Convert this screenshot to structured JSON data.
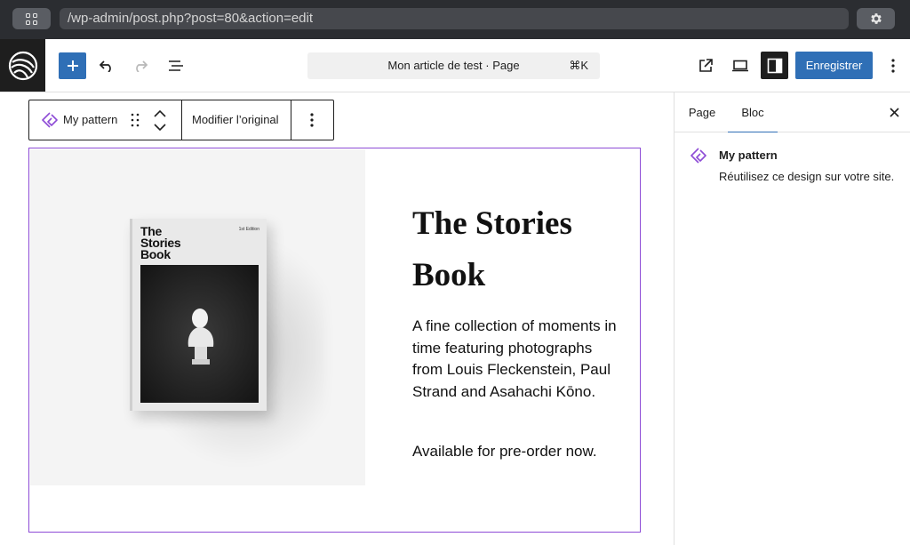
{
  "browser": {
    "url": "/wp-admin/post.php?post=80&action=edit"
  },
  "header": {
    "doc_title": "Mon article de test · Page",
    "shortcut": "⌘K",
    "save_label": "Enregistrer"
  },
  "block_toolbar": {
    "block_name": "My pattern",
    "edit_original_label": "Modifier l’original"
  },
  "content": {
    "book_cover": {
      "title_lines": [
        "The",
        "Stories",
        "Book"
      ],
      "edition": "1st Edition"
    },
    "heading": "The Stories Book",
    "paragraph1": "A fine collection of moments in time featuring photographs from Louis Fleckenstein, Paul Strand and Asahachi Kōno.",
    "paragraph2": "Available for pre-order now."
  },
  "sidebar": {
    "tabs": [
      {
        "label": "Page",
        "active": false
      },
      {
        "label": "Bloc",
        "active": true
      }
    ],
    "block_card": {
      "name": "My pattern",
      "description": "Réutilisez ce design sur votre site."
    }
  },
  "colors": {
    "primary": "#2f6fb6",
    "pattern_accent": "#8d4bd6",
    "browser_chrome": "#2b2d31",
    "logo_bg": "#1e1e1e"
  },
  "icons": [
    "tabs-grid-icon",
    "gear-icon",
    "site-logo",
    "plus-icon",
    "undo-icon",
    "redo-icon",
    "document-overview-icon",
    "external-link-icon",
    "device-preview-icon",
    "sidebar-toggle-icon",
    "more-vertical-icon",
    "synced-pattern-icon",
    "drag-handle-icon",
    "chevron-up-icon",
    "chevron-down-icon",
    "close-icon"
  ]
}
